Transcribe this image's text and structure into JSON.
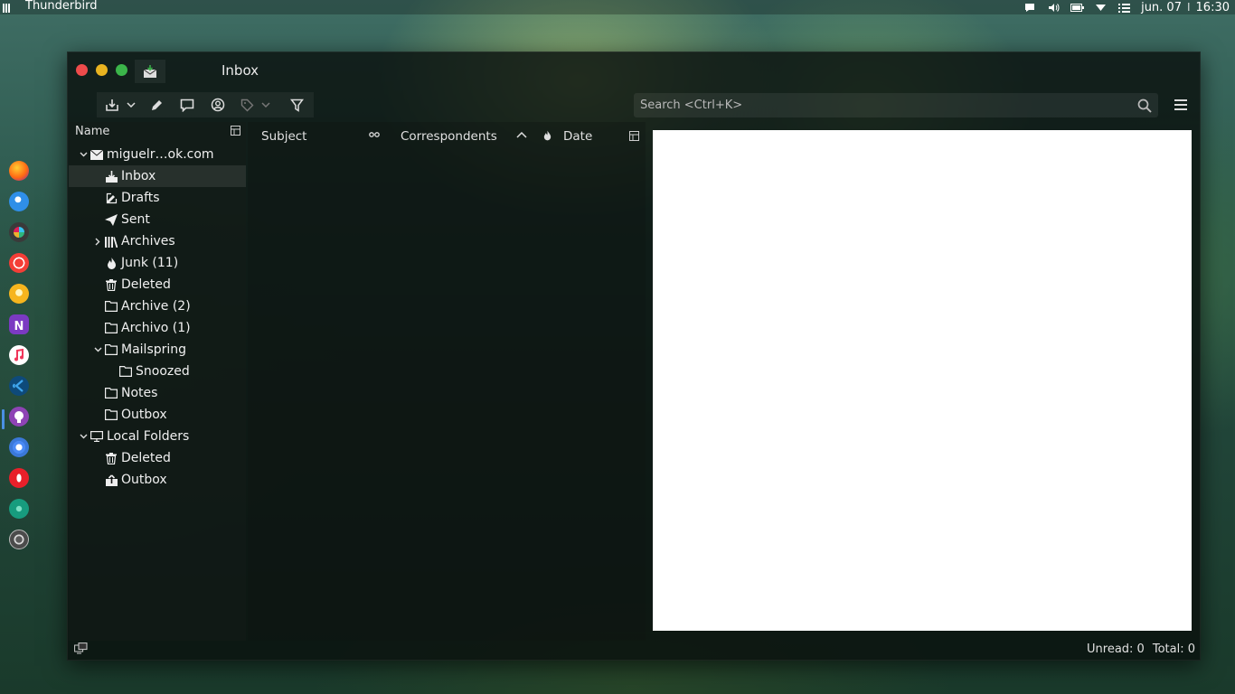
{
  "top_panel": {
    "app_name": "Thunderbird",
    "date": "jun. 07",
    "separator": "I",
    "time": "16:30",
    "tray_icons": [
      "chat-icon",
      "volume-icon",
      "battery-icon",
      "wifi-icon",
      "menu-list-icon"
    ]
  },
  "dock": {
    "items": [
      "firefox",
      "thunderbird",
      "slack",
      "pocket-casts",
      "idea-bulb",
      "onenote",
      "music",
      "vscode",
      "github",
      "chrome",
      "opera",
      "gitkraken",
      "system-settings"
    ]
  },
  "window": {
    "title": "Inbox",
    "search_placeholder": "Search <Ctrl+K>"
  },
  "folder_pane": {
    "header_label": "Name",
    "account": "miguelr…ok.com",
    "folders": [
      {
        "label": "Inbox"
      },
      {
        "label": "Drafts"
      },
      {
        "label": "Sent"
      },
      {
        "label": "Archives"
      },
      {
        "label": "Junk (11)"
      },
      {
        "label": "Deleted"
      },
      {
        "label": "Archive (2)"
      },
      {
        "label": "Archivo (1)"
      },
      {
        "label": "Mailspring"
      },
      {
        "label": "Snoozed"
      },
      {
        "label": "Notes"
      },
      {
        "label": "Outbox"
      }
    ],
    "local_folders": {
      "label": "Local Folders",
      "folders": [
        {
          "label": "Deleted"
        },
        {
          "label": "Outbox"
        }
      ]
    }
  },
  "thread_pane": {
    "columns": {
      "subject": "Subject",
      "correspondents": "Correspondents",
      "date": "Date"
    }
  },
  "statusbar": {
    "unread": "Unread: 0",
    "total": "Total: 0"
  },
  "colors": {
    "close": "#ee4b4b",
    "minimize": "#e9b320",
    "maximize": "#3bb54a",
    "dock_active": "#4a90e2"
  }
}
